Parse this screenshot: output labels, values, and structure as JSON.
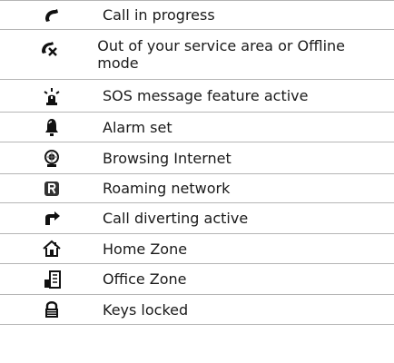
{
  "status_icons": [
    {
      "icon": "call-in-progress-icon",
      "description": "Call in progress"
    },
    {
      "icon": "out-of-service-icon",
      "description": "Out of your service area or Offline mode"
    },
    {
      "icon": "sos-message-icon",
      "description": "SOS message feature active"
    },
    {
      "icon": "alarm-bell-icon",
      "description": "Alarm set"
    },
    {
      "icon": "browsing-globe-icon",
      "description": "Browsing Internet"
    },
    {
      "icon": "roaming-r-icon",
      "description": "Roaming network"
    },
    {
      "icon": "call-divert-icon",
      "description": "Call diverting active"
    },
    {
      "icon": "home-zone-icon",
      "description": "Home Zone"
    },
    {
      "icon": "office-zone-icon",
      "description": "Office Zone"
    },
    {
      "icon": "keys-locked-icon",
      "description": "Keys locked"
    }
  ]
}
